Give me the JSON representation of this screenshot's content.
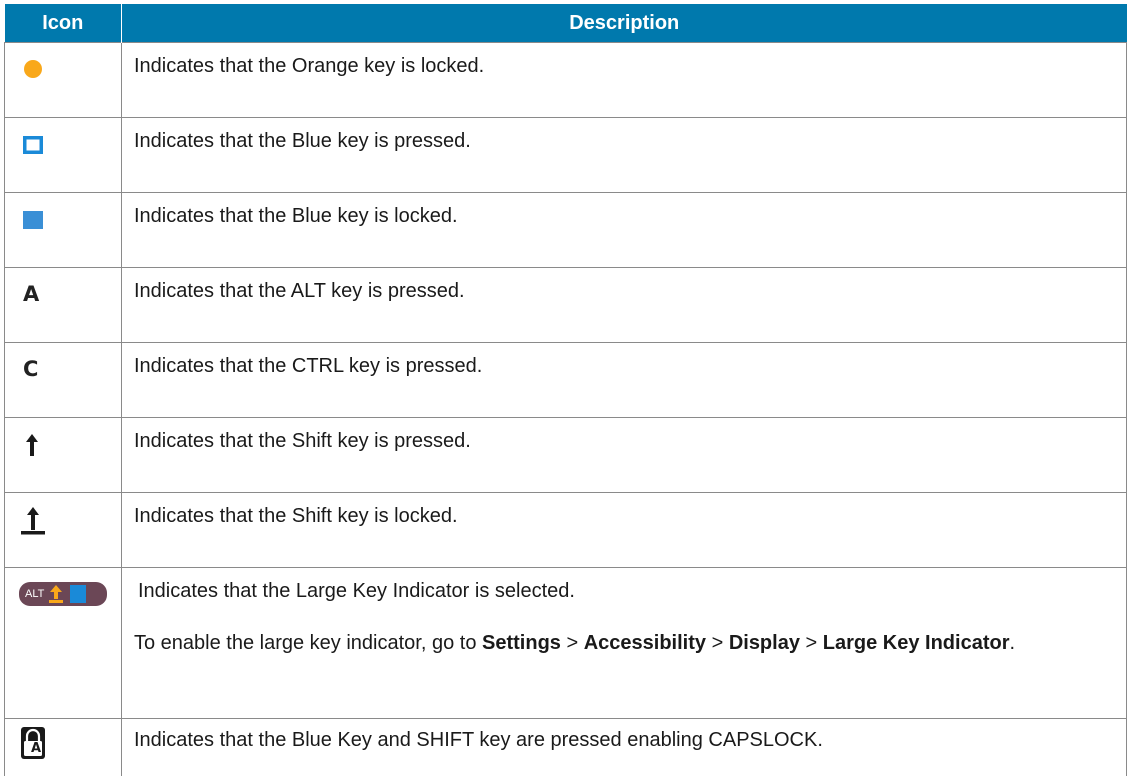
{
  "table": {
    "headers": {
      "icon": "Icon",
      "description": "Description"
    },
    "rows": [
      {
        "icon": "orange-circle-icon",
        "description": "Indicates that the Orange key is locked."
      },
      {
        "icon": "blue-square-outline-icon",
        "description": "Indicates that the Blue key is pressed."
      },
      {
        "icon": "blue-square-filled-icon",
        "description": "Indicates that the Blue key is locked."
      },
      {
        "icon": "alt-a-icon",
        "icon_text": "A",
        "description": "Indicates that the ALT key is pressed."
      },
      {
        "icon": "ctrl-c-icon",
        "icon_text": "C",
        "description": "Indicates that the CTRL key is pressed."
      },
      {
        "icon": "shift-arrow-icon",
        "description": "Indicates that the Shift key is pressed."
      },
      {
        "icon": "shift-locked-icon",
        "description": "Indicates that the Shift key is locked."
      },
      {
        "icon": "large-key-indicator-icon",
        "icon_text": "ALT",
        "description": "Indicates that the Large Key Indicator is selected.",
        "note": {
          "prefix": "To enable the large key indicator, go to ",
          "step1": "Settings",
          "sep1": " > ",
          "step2": "Accessibility",
          "sep2": " > ",
          "step3": "Display",
          "sep3": " > ",
          "step4": "Large Key Indicator",
          "suffix": "."
        }
      },
      {
        "icon": "capslock-lock-icon",
        "icon_text": "A",
        "description": "Indicates that the Blue Key and SHIFT key are pressed enabling CAPSLOCK."
      }
    ]
  },
  "colors": {
    "header_bg": "#0079ad",
    "orange": "#f9a81a",
    "blue": "#1a8ad8",
    "blue_filled": "#3a8fd6",
    "indicator_bg": "#6b4756"
  }
}
